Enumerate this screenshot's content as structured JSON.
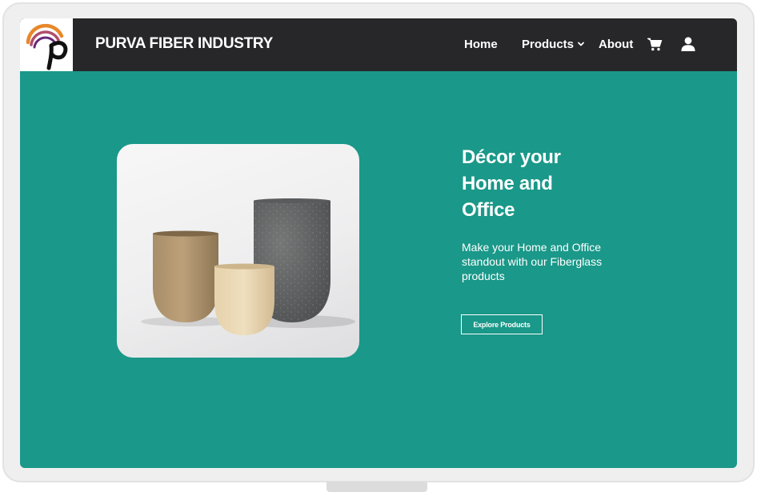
{
  "brand": {
    "name": "PURVA FIBER INDUSTRY",
    "logo_icon": "purva-p-logo-icon"
  },
  "nav": {
    "items": [
      {
        "label": "Home"
      },
      {
        "label": "Products",
        "has_dropdown": true
      },
      {
        "label": "About"
      }
    ],
    "icons": [
      "cart-icon",
      "user-icon"
    ]
  },
  "hero": {
    "title": "Décor your Home and Office",
    "subtitle": "Make your Home and Office standout with our Fiberglass products",
    "cta_label": "Explore Products",
    "image": "planters-image"
  },
  "colors": {
    "nav_background": "#27272a",
    "hero_background": "#1a9889",
    "text": "#ffffff",
    "logo_orange": "#e8872a",
    "logo_purple": "#6a2a78"
  }
}
